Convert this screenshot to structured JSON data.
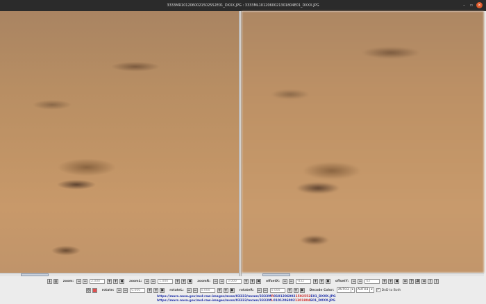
{
  "window": {
    "title": "3333MR1012060021502552E01_DXXX.JPG : 3333ML1012060021301804E01_DXXX.JPG",
    "minimize": "–",
    "maximize": "▫",
    "close": "×"
  },
  "toolbar1": {
    "zoom_label": "zoom:",
    "zoom_value": "2.000",
    "zoomL_label": "zoomL:",
    "zoomL_value": "1.000",
    "zoomR_label": "zoomR:",
    "zoomR_value": "3.000",
    "offsetX_label": "offsetX:",
    "offsetX_value": "-832",
    "offsetY_label": "offsetY:",
    "offsetY_value": "43",
    "minus": "−",
    "plus": "+",
    "reset": "✖",
    "help": "?",
    "grid": "#",
    "eq": "=",
    "sep": "⁝"
  },
  "toolbar2": {
    "rotate_label": "rotate:",
    "rotate_value": "0.000",
    "rotateL_label": "rotateL:",
    "rotateL_value": "0.000",
    "rotateR_label": "rotateR:",
    "rotateR_value": "0.000",
    "decode_label": "Decode Color:",
    "decode_left": "AUTO3",
    "decode_right": "AUTO3",
    "dnd_label": "DnD to Both",
    "dnd_checked": "✓"
  },
  "urls": [
    {
      "p1": "https://mars.nasa.gov/msl-raw-images/msss/03333/mcam/3333M",
      "p2": "R",
      "p3": "0101206002",
      "p4": "1502552",
      "p5": "E01_DXXX.JPG"
    },
    {
      "p1": "https://mars.nasa.gov/msl-raw-images/msss/03333/mcam/3333M",
      "p2": "L",
      "p3": "0101206002",
      "p4": "1301804",
      "p5": "E01_DXXX.JPG"
    }
  ]
}
